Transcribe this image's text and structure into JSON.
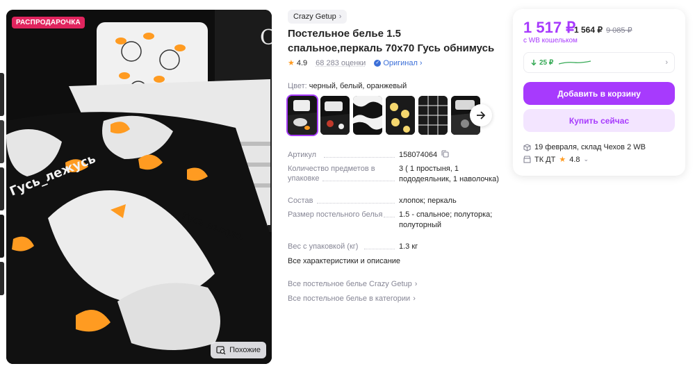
{
  "gallery": {
    "sale_badge": "РАСПРОДАРОЧКА",
    "similar_label": "Похожие",
    "image_text_1": "Гусь_лежусь",
    "image_text_2": "Гусь лежусь"
  },
  "product": {
    "brand": "Crazy Getup",
    "title": "Постельное белье 1.5 спальное,перкаль 70х70 Гусь обнимусь",
    "rating": "4.9",
    "reviews": "68 283 оценки",
    "original_label": "Оригинал",
    "color_label": "Цвет:",
    "color_value": "черный, белый, оранжевый"
  },
  "specs": [
    {
      "key": "Артикул",
      "value": "158074064"
    },
    {
      "key": "Количество предметов в упаковке",
      "value": "3 ( 1 простыня, 1 пододеяльник, 1 наволочка)"
    },
    {
      "key": "Состав",
      "value": "хлопок; перкаль"
    },
    {
      "key": "Размер постельного белья",
      "value": "1.5 - спальное; полуторка; полуторный"
    },
    {
      "key": "Вес с упаковкой (кг)",
      "value": "1.3 кг"
    }
  ],
  "all_specs_label": "Все характеристики и описание",
  "links": {
    "brand_link": "Все постельное белье Crazy Getup",
    "category_link": "Все постельное белье в категории"
  },
  "buy": {
    "price": "1 517 ₽",
    "price_no_wallet": "1 564 ₽",
    "price_old": "9 085 ₽",
    "wallet_label": "с WB кошельком",
    "cashback": "25 ₽",
    "add_to_cart": "Добавить в корзину",
    "buy_now": "Купить сейчас",
    "delivery": "19 февраля, склад Чехов 2 WB",
    "seller": "ТК ДТ",
    "seller_rating": "4.8"
  },
  "colors": {
    "accent": "#a73afd",
    "accent_light": "#f3e5ff",
    "sale": "#e0245e",
    "star": "#ff9b21",
    "link_blue": "#3b6fd8",
    "cashback_green": "#33a853"
  }
}
